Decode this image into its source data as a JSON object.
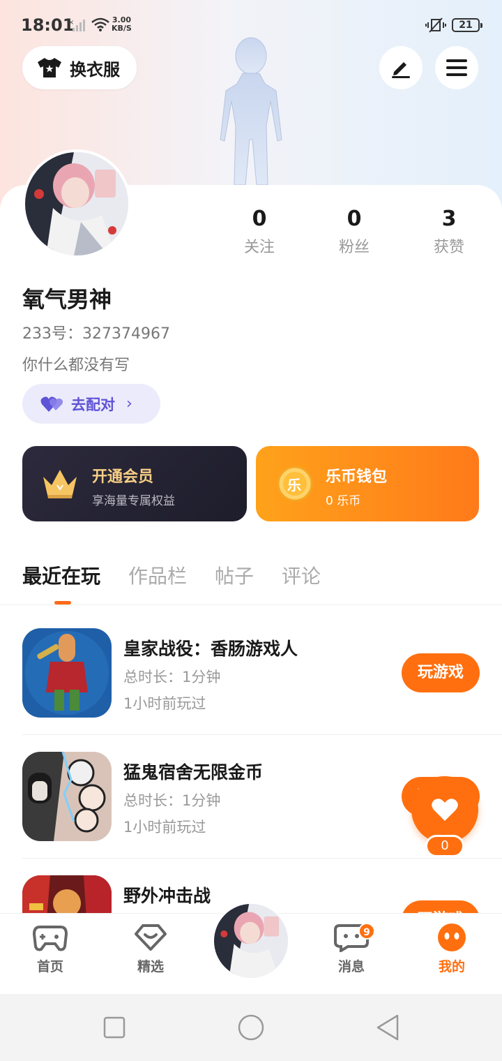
{
  "status_bar": {
    "time": "18:01",
    "speed_value": "3.00",
    "speed_unit": "KB/S",
    "battery": "21"
  },
  "header": {
    "outfit_label": "换衣服"
  },
  "profile": {
    "name": "氧气男神",
    "id_text": "233号：327374967",
    "bio": "你什么都没有写",
    "match_label": "去配对"
  },
  "stats": [
    {
      "value": "0",
      "label": "关注"
    },
    {
      "value": "0",
      "label": "粉丝"
    },
    {
      "value": "3",
      "label": "获赞"
    }
  ],
  "vip": {
    "title": "开通会员",
    "subtitle": "享海量专属权益"
  },
  "wallet": {
    "coin_glyph": "乐",
    "title": "乐币钱包",
    "subtitle": "0 乐币"
  },
  "tabs": [
    "最近在玩",
    "作品栏",
    "帖子",
    "评论"
  ],
  "games": [
    {
      "title": "皇家战役：香肠游戏人",
      "duration": "总时长：1分钟",
      "last_played": "1小时前玩过",
      "button": "玩游戏"
    },
    {
      "title": "猛鬼宿舍无限金币",
      "duration": "总时长：1分钟",
      "last_played": "1小时前玩过",
      "button": "玩游戏"
    },
    {
      "title": "野外冲击战",
      "duration": "",
      "last_played": "",
      "button": "玩游戏"
    }
  ],
  "fab": {
    "count": "0"
  },
  "nav": {
    "home": "首页",
    "featured": "精选",
    "messages": "消息",
    "messages_badge": "9",
    "mine": "我的"
  },
  "colors": {
    "accent": "#ff6f0f",
    "match_purple": "#5f53d6",
    "vip_gold": "#f8cf86"
  }
}
